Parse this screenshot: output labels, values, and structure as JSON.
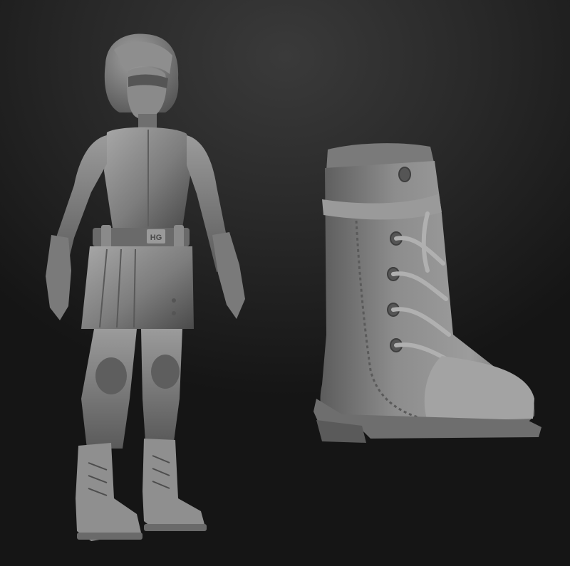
{
  "scene": {
    "subject_figure": "sculpted-girl-figure",
    "subject_detail": "sculpted-boot-closeup",
    "belt_buckle_text": "HG"
  },
  "colors": {
    "background_top": "#3a3a3a",
    "background_bottom": "#151515",
    "clay_light": "#a4a4a4",
    "clay_mid": "#7c7c7c",
    "clay_dark": "#4f4f4f"
  }
}
